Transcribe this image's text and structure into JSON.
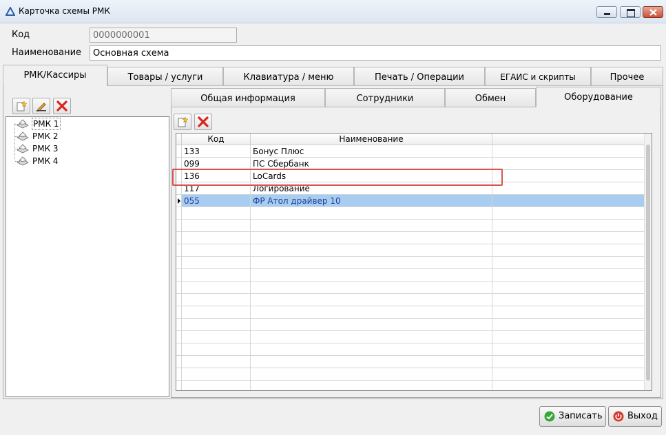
{
  "window": {
    "title": "Карточка схемы РМК"
  },
  "header": {
    "code_label": "Код",
    "code_value": "0000000001",
    "name_label": "Наименование",
    "name_value": "Основная схема"
  },
  "main_tabs": [
    {
      "label": "РМК/Кассиры",
      "active": true
    },
    {
      "label": "Товары / услуги"
    },
    {
      "label": "Клавиатура / меню"
    },
    {
      "label": "Печать / Операции"
    },
    {
      "label": "ЕГАИС и скрипты"
    },
    {
      "label": "Прочее"
    }
  ],
  "tree": {
    "items": [
      {
        "label": "РМК 1",
        "selected": true
      },
      {
        "label": "РМК 2"
      },
      {
        "label": "РМК 3"
      },
      {
        "label": "РМК 4"
      }
    ]
  },
  "sub_tabs": [
    {
      "label": "Общая информация"
    },
    {
      "label": "Сотрудники"
    },
    {
      "label": "Обмен"
    },
    {
      "label": "Оборудование",
      "active": true
    }
  ],
  "grid": {
    "columns": [
      "Код",
      "Наименование",
      ""
    ],
    "rows": [
      {
        "code": "133",
        "name": "Бонус Плюс"
      },
      {
        "code": "099",
        "name": "ПС Сбербанк"
      },
      {
        "code": "136",
        "name": "LoCards"
      },
      {
        "code": "117",
        "name": "Логирование"
      },
      {
        "code": "055",
        "name": "ФР Атол драйвер 10",
        "selected": true
      }
    ]
  },
  "buttons": {
    "save": "Записать",
    "exit": "Выход"
  },
  "colors": {
    "selection": "#a8cdf1",
    "highlight_box": "#d9534f",
    "save_icon": "#3aa53a",
    "exit_icon": "#d23a2a"
  }
}
